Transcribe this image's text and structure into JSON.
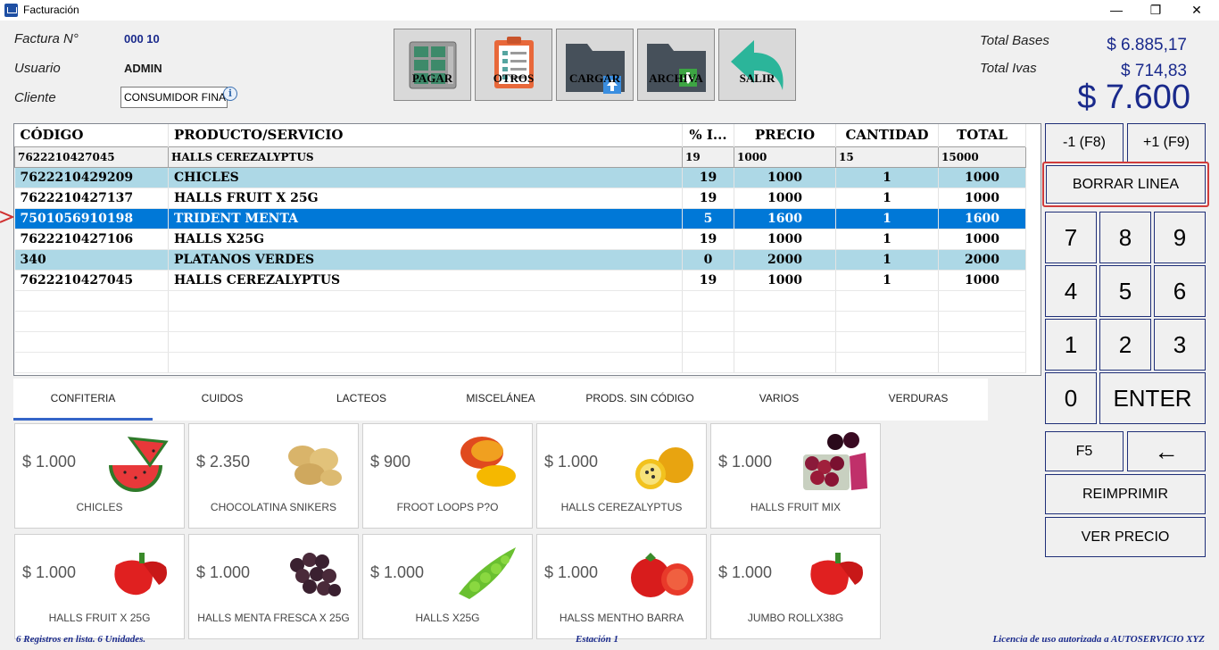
{
  "window": {
    "title": "Facturación",
    "minimize": "—",
    "restore": "❐",
    "close": "✕"
  },
  "header": {
    "factura_label": "Factura N°",
    "factura_value": "000  10",
    "usuario_label": "Usuario",
    "usuario_value": "ADMIN",
    "cliente_label": "Cliente",
    "cliente_value": "CONSUMIDOR FINAL"
  },
  "toolbar": [
    {
      "label": "PAGAR",
      "icon": "cash-register-icon"
    },
    {
      "label": "OTROS",
      "icon": "clipboard-icon"
    },
    {
      "label": "CARGAR",
      "icon": "folder-upload-icon"
    },
    {
      "label": "ARCHIVA",
      "icon": "folder-download-icon"
    },
    {
      "label": "SALIR",
      "icon": "undo-arrow-icon"
    }
  ],
  "totals": {
    "bases_label": "Total Bases",
    "bases_value": "$ 6.885,17",
    "ivas_label": "Total Ivas",
    "ivas_value": "$ 714,83",
    "grand_total": "$ 7.600"
  },
  "grid": {
    "columns": [
      "CÓDIGO",
      "PRODUCTO/SERVICIO",
      "% I...",
      "PRECIO",
      "CANTIDAD",
      "TOTAL"
    ],
    "edit_row": [
      "7622210427045",
      "HALLS CEREZALYPTUS",
      "19",
      "1000",
      "15",
      "15000"
    ],
    "rows": [
      [
        "7622210429209",
        "CHICLES",
        "19",
        "1000",
        "1",
        "1000"
      ],
      [
        "7622210427137",
        "HALLS FRUIT X 25G",
        "19",
        "1000",
        "1",
        "1000"
      ],
      [
        "7501056910198",
        "TRIDENT MENTA",
        "5",
        "1600",
        "1",
        "1600"
      ],
      [
        "7622210427106",
        "HALLS X25G",
        "19",
        "1000",
        "1",
        "1000"
      ],
      [
        "340",
        "PLATANOS VERDES",
        "0",
        "2000",
        "1",
        "2000"
      ],
      [
        "7622210427045",
        "HALLS CEREZALYPTUS",
        "19",
        "1000",
        "1",
        "1000"
      ]
    ]
  },
  "tabs": [
    "CONFITERIA",
    "CUIDOS",
    "LACTEOS",
    "MISCELÁNEA",
    "PRODS. SIN CÓDIGO",
    "VARIOS",
    "VERDURAS"
  ],
  "products": [
    {
      "price": "$ 1.000",
      "name": "CHICLES",
      "image": "watermelon"
    },
    {
      "price": "$ 2.350",
      "name": "CHOCOLATINA SNIKERS",
      "image": "potatoes"
    },
    {
      "price": "$ 900",
      "name": "FROOT LOOPS P?O",
      "image": "mango"
    },
    {
      "price": "$ 1.000",
      "name": "HALLS CEREZALYPTUS",
      "image": "passion-fruit"
    },
    {
      "price": "$ 1.000",
      "name": "HALLS FRUIT MIX",
      "image": "berries"
    },
    {
      "price": "$ 1.000",
      "name": "HALLS FRUIT X 25G",
      "image": "red-pepper"
    },
    {
      "price": "$ 1.000",
      "name": "HALLS MENTA FRESCA X 25G",
      "image": "grapes"
    },
    {
      "price": "$ 1.000",
      "name": "HALLS X25G",
      "image": "peas"
    },
    {
      "price": "$ 1.000",
      "name": "HALSS MENTHO BARRA",
      "image": "tomato"
    },
    {
      "price": "$ 1.000",
      "name": "JUMBO ROLLX38G",
      "image": "red-pepper"
    }
  ],
  "keypad": {
    "minus": "-1 (F8)",
    "plus": "+1 (F9)",
    "borrar": "BORRAR LINEA",
    "n7": "7",
    "n8": "8",
    "n9": "9",
    "n4": "4",
    "n5": "5",
    "n6": "6",
    "n1": "1",
    "n2": "2",
    "n3": "3",
    "n0": "0",
    "enter": "ENTER",
    "f5": "F5",
    "back": "←",
    "reimprimir": "REIMPRIMIR",
    "ver_precio": "VER PRECIO"
  },
  "status": {
    "left": "6 Registros en lista. 6 Unidades.",
    "center": "Estación 1",
    "right": "Licencia de uso autorizada a AUTOSERVICIO XYZ"
  }
}
